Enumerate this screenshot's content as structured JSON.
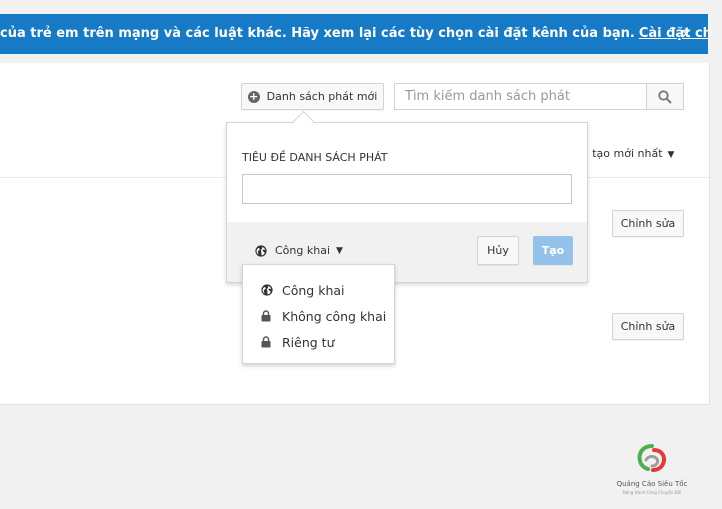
{
  "banner": {
    "message": "của trẻ em trên mạng và các luật khác. Hãy xem lại các tùy chọn cài đặt kênh của bạn.",
    "link_label": "Cài đặt cho kênh",
    "close_glyph": "×",
    "background": "#167ac6"
  },
  "toolbar": {
    "new_playlist_label": "Danh sách phát mới",
    "new_playlist_icon": "plus-circle-icon",
    "search_placeholder": "Tìm kiếm danh sách phát",
    "search_icon": "search-icon"
  },
  "sort": {
    "label": "ã tạo mới nhất",
    "caret": "▼"
  },
  "rows": [
    {
      "edit_label": "Chỉnh sửa"
    },
    {
      "edit_label": "Chỉnh sửa"
    }
  ],
  "create_dialog": {
    "title_label": "TIÊU ĐỀ DANH SÁCH PHÁT",
    "title_value": "",
    "privacy_selected": "Công khai",
    "privacy_icon": "globe-icon",
    "caret": "▼",
    "cancel_label": "Hủy",
    "create_label": "Tạo",
    "create_color": "#95c2ea"
  },
  "privacy_menu": {
    "options": [
      {
        "label": "Công khai",
        "icon": "globe-icon"
      },
      {
        "label": "Không công khai",
        "icon": "lock-icon"
      },
      {
        "label": "Riêng tư",
        "icon": "lock-icon"
      }
    ]
  },
  "watermark": {
    "name": "Quảng Cáo Siêu Tốc",
    "tagline": "Nâng Hành Công Chuyển Đổi"
  }
}
